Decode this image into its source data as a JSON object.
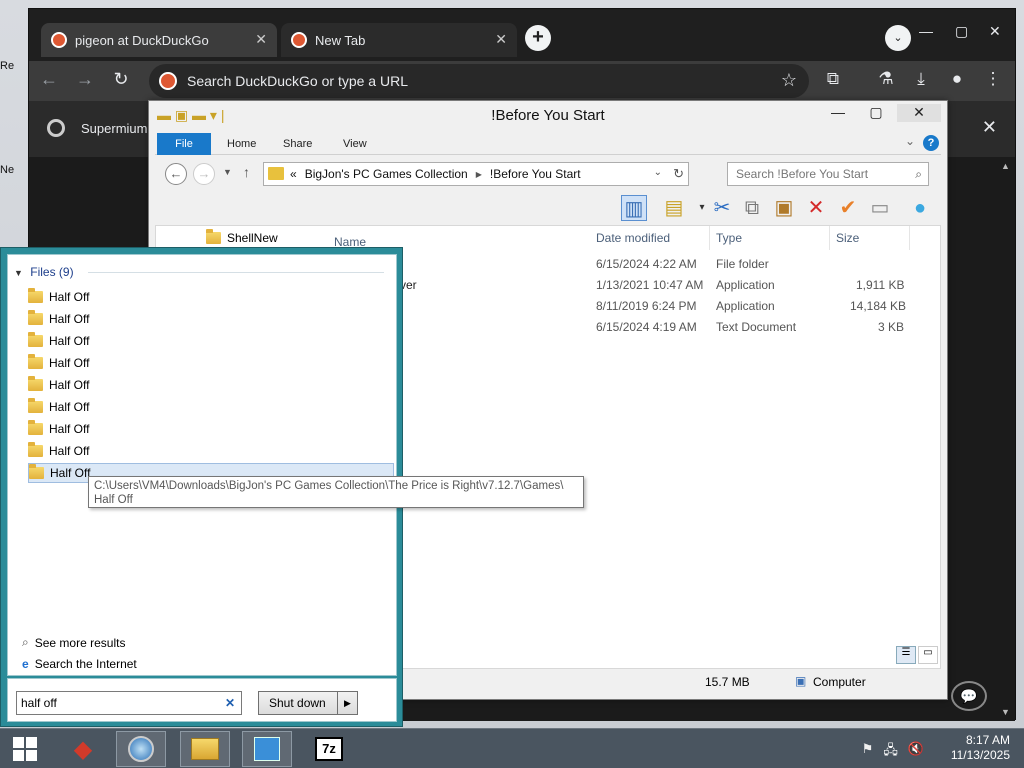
{
  "desktop": {
    "frag1": "Re",
    "frag2": "Ne"
  },
  "browser": {
    "tabs": [
      {
        "label": "pigeon at DuckDuckGo"
      },
      {
        "label": "New Tab"
      }
    ],
    "omnibox_placeholder": "Search DuckDuckGo or type a URL",
    "infobar_text": "Supermium"
  },
  "explorer": {
    "title": "!Before You Start",
    "ribbon_tabs": [
      "File",
      "Home",
      "Share",
      "View"
    ],
    "address": {
      "root": "«",
      "crumb1": "BigJon's PC Games Collection",
      "crumb2": "!Before You Start"
    },
    "search_placeholder": "Search !Before You Start",
    "nav_item": "ShellNew",
    "columns": [
      "Name",
      "Date modified",
      "Type",
      "Size"
    ],
    "rows": [
      {
        "name": "",
        "date": "6/15/2024 4:22 AM",
        "type": "File folder",
        "size": ""
      },
      {
        "name": "ver",
        "date": "1/13/2021 10:47 AM",
        "type": "Application",
        "size": "1,911 KB"
      },
      {
        "name": "",
        "date": "8/11/2019 6:24 PM",
        "type": "Application",
        "size": "14,184 KB"
      },
      {
        "name": "",
        "date": "6/15/2024 4:19 AM",
        "type": "Text Document",
        "size": "3 KB"
      }
    ],
    "status": {
      "size": "15.7 MB",
      "location": "Computer"
    }
  },
  "startmenu": {
    "group_label": "Files (9)",
    "items": [
      "Half Off",
      "Half Off",
      "Half Off",
      "Half Off",
      "Half Off",
      "Half Off",
      "Half Off",
      "Half Off",
      "Half Off"
    ],
    "tooltip_line1": "C:\\Users\\VM4\\Downloads\\BigJon's PC Games Collection\\The Price is Right\\v7.12.7\\Games\\",
    "tooltip_line2": "Half Off",
    "see_more": "See more results",
    "search_internet": "Search the Internet",
    "search_value": "half off",
    "shutdown_label": "Shut down"
  },
  "taskbar": {
    "time": "8:17 AM",
    "date": "11/13/2025"
  }
}
